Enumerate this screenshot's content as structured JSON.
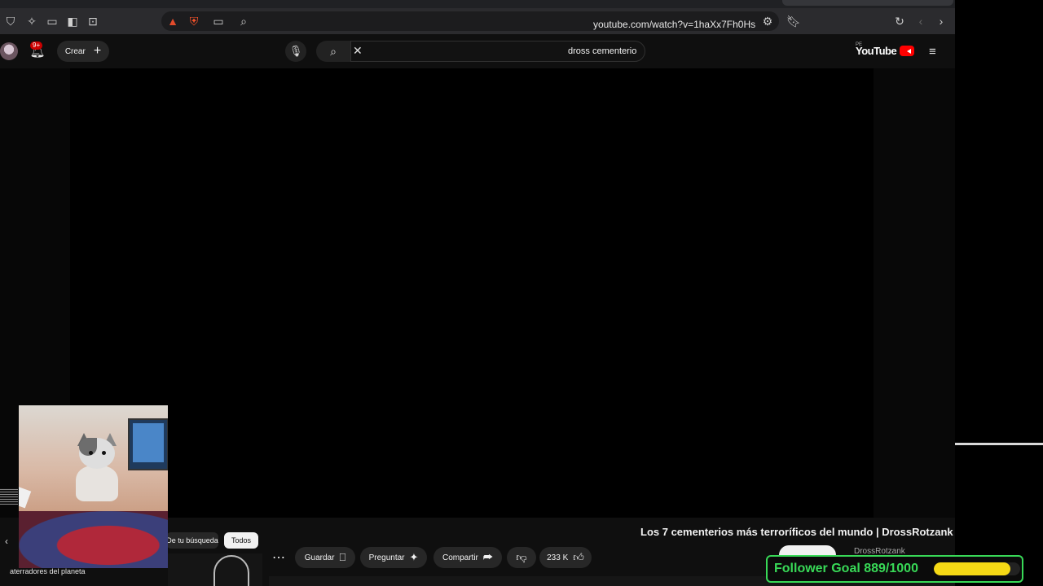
{
  "browser": {
    "url": "youtube.com/watch?v=1haXx7Fh0Hs"
  },
  "masthead": {
    "create_label": "Crear",
    "notification_count": "9+",
    "search_value": "dross cementerio",
    "logo_text": "YouTube",
    "country_code": "PE"
  },
  "video": {
    "title": "Los 7 cementerios más terroríficos del mundo | DrossRotzank",
    "channel": "DrossRotzank",
    "likes": "233 K",
    "share_label": "Compartir",
    "ask_label": "Preguntar",
    "save_label": "Guardar"
  },
  "chips": {
    "all": "Todos",
    "from_search": "De tu búsqueda"
  },
  "recommended": {
    "first_title": "aterradores del planeta"
  },
  "follower_goal": {
    "label": "Follower Goal 889/1000",
    "current": 889,
    "target": 1000,
    "accent": "#38d957",
    "bar_color": "#f5d915"
  }
}
